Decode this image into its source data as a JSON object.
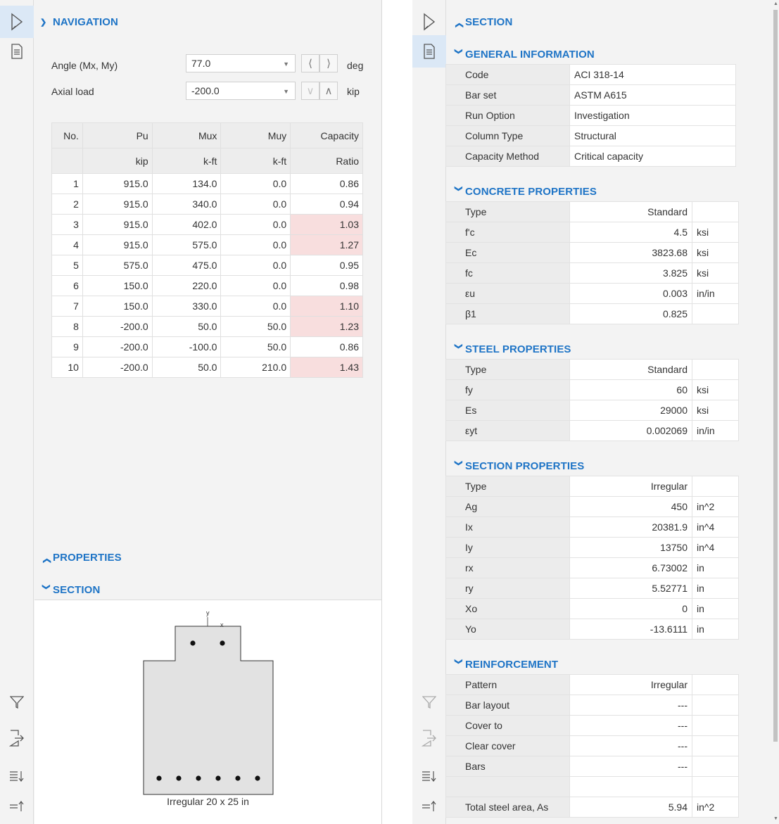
{
  "left": {
    "navigation": {
      "title": "NAVIGATION",
      "angle_label": "Angle (Mx, My)",
      "angle_value": "77.0",
      "angle_unit": "deg",
      "axial_label": "Axial load",
      "axial_value": "-200.0",
      "axial_unit": "kip"
    },
    "table": {
      "headers": [
        "No.",
        "Pu",
        "Mux",
        "Muy",
        "Capacity"
      ],
      "units": [
        "",
        "kip",
        "k-ft",
        "k-ft",
        "Ratio"
      ],
      "rows": [
        {
          "no": "1",
          "pu": "915.0",
          "mux": "134.0",
          "muy": "0.0",
          "ratio": "0.86",
          "over": false
        },
        {
          "no": "2",
          "pu": "915.0",
          "mux": "340.0",
          "muy": "0.0",
          "ratio": "0.94",
          "over": false
        },
        {
          "no": "3",
          "pu": "915.0",
          "mux": "402.0",
          "muy": "0.0",
          "ratio": "1.03",
          "over": true
        },
        {
          "no": "4",
          "pu": "915.0",
          "mux": "575.0",
          "muy": "0.0",
          "ratio": "1.27",
          "over": true
        },
        {
          "no": "5",
          "pu": "575.0",
          "mux": "475.0",
          "muy": "0.0",
          "ratio": "0.95",
          "over": false
        },
        {
          "no": "6",
          "pu": "150.0",
          "mux": "220.0",
          "muy": "0.0",
          "ratio": "0.98",
          "over": false
        },
        {
          "no": "7",
          "pu": "150.0",
          "mux": "330.0",
          "muy": "0.0",
          "ratio": "1.10",
          "over": true
        },
        {
          "no": "8",
          "pu": "-200.0",
          "mux": "50.0",
          "muy": "50.0",
          "ratio": "1.23",
          "over": true
        },
        {
          "no": "9",
          "pu": "-200.0",
          "mux": "-100.0",
          "muy": "50.0",
          "ratio": "0.86",
          "over": false
        },
        {
          "no": "10",
          "pu": "-200.0",
          "mux": "50.0",
          "muy": "210.0",
          "ratio": "1.43",
          "over": true
        }
      ]
    },
    "properties_title": "PROPERTIES",
    "section_title": "SECTION",
    "section_caption": "Irregular 20 x 25 in",
    "axis_y": "y",
    "axis_x": "x"
  },
  "right": {
    "section_title": "SECTION",
    "general": {
      "title": "GENERAL INFORMATION",
      "rows": [
        {
          "k": "Code",
          "v": "ACI 318-14"
        },
        {
          "k": "Bar set",
          "v": "ASTM A615"
        },
        {
          "k": "Run Option",
          "v": "Investigation"
        },
        {
          "k": "Column Type",
          "v": "Structural"
        },
        {
          "k": "Capacity Method",
          "v": "Critical capacity"
        }
      ]
    },
    "concrete": {
      "title": "CONCRETE PROPERTIES",
      "rows": [
        {
          "k": "Type",
          "v": "Standard",
          "u": ""
        },
        {
          "k": "f'c",
          "v": "4.5",
          "u": "ksi"
        },
        {
          "k": "Ec",
          "v": "3823.68",
          "u": "ksi"
        },
        {
          "k": "fc",
          "v": "3.825",
          "u": "ksi"
        },
        {
          "k": "εu",
          "v": "0.003",
          "u": "in/in"
        },
        {
          "k": "β1",
          "v": "0.825",
          "u": ""
        }
      ]
    },
    "steel": {
      "title": "STEEL PROPERTIES",
      "rows": [
        {
          "k": "Type",
          "v": "Standard",
          "u": ""
        },
        {
          "k": "fy",
          "v": "60",
          "u": "ksi"
        },
        {
          "k": "Es",
          "v": "29000",
          "u": "ksi"
        },
        {
          "k": "εyt",
          "v": "0.002069",
          "u": "in/in"
        }
      ]
    },
    "section_props": {
      "title": "SECTION PROPERTIES",
      "rows": [
        {
          "k": "Type",
          "v": "Irregular",
          "u": ""
        },
        {
          "k": "Ag",
          "v": "450",
          "u": "in^2"
        },
        {
          "k": "Ix",
          "v": "20381.9",
          "u": "in^4"
        },
        {
          "k": "Iy",
          "v": "13750",
          "u": "in^4"
        },
        {
          "k": "rx",
          "v": "6.73002",
          "u": "in"
        },
        {
          "k": "ry",
          "v": "5.52771",
          "u": "in"
        },
        {
          "k": "Xo",
          "v": "0",
          "u": "in"
        },
        {
          "k": "Yo",
          "v": "-13.6111",
          "u": "in"
        }
      ]
    },
    "reinforcement": {
      "title": "REINFORCEMENT",
      "rows": [
        {
          "k": "Pattern",
          "v": "Irregular",
          "u": ""
        },
        {
          "k": "Bar layout",
          "v": "---",
          "u": ""
        },
        {
          "k": "Cover to",
          "v": "---",
          "u": ""
        },
        {
          "k": "Clear cover",
          "v": "---",
          "u": ""
        },
        {
          "k": "Bars",
          "v": "---",
          "u": ""
        },
        {
          "k": "",
          "v": "",
          "u": ""
        },
        {
          "k": "Total steel area, As",
          "v": "5.94",
          "u": "in^2"
        }
      ]
    }
  },
  "colors": {
    "accent": "#1e74c6",
    "over_capacity": "#f8dede",
    "active_tool": "#dbe8f6"
  },
  "icons": [
    "cursor-icon",
    "document-icon",
    "filter-icon",
    "export-icon",
    "sort-descending-icon",
    "sort-ascending-icon"
  ]
}
